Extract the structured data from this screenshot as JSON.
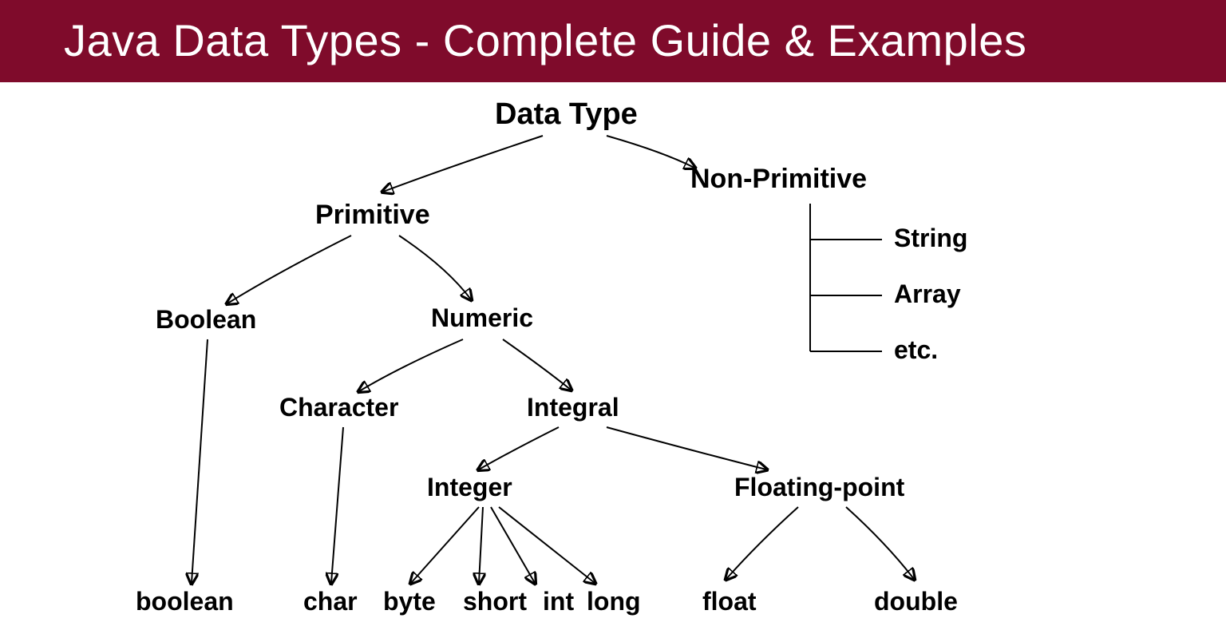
{
  "header": {
    "title": "Java Data Types - Complete Guide & Examples"
  },
  "tree": {
    "root": "Data Type",
    "primitive": "Primitive",
    "non_primitive": "Non-Primitive",
    "boolean_branch": "Boolean",
    "numeric_branch": "Numeric",
    "character_branch": "Character",
    "integral_branch": "Integral",
    "integer_branch": "Integer",
    "floating_branch": "Floating-point",
    "leaf_boolean": "boolean",
    "leaf_char": "char",
    "leaf_byte": "byte",
    "leaf_short": "short",
    "leaf_int": "int",
    "leaf_long": "long",
    "leaf_float": "float",
    "leaf_double": "double",
    "np_string": "String",
    "np_array": "Array",
    "np_etc": "etc."
  }
}
